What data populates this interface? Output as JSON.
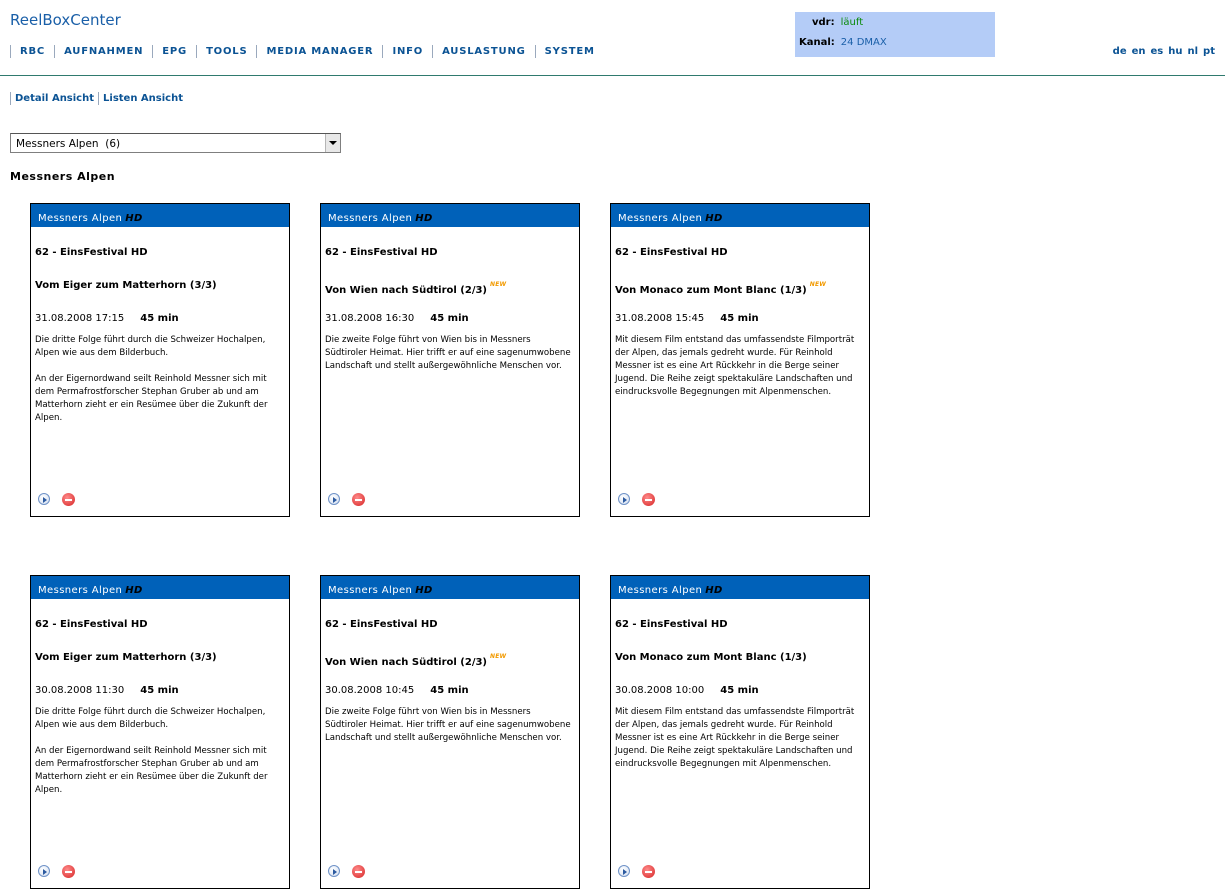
{
  "brand": "ReelBoxCenter",
  "nav": [
    "RBC",
    "AUFNAHMEN",
    "EPG",
    "TOOLS",
    "MEDIA MANAGER",
    "INFO",
    "AUSLASTUNG",
    "SYSTEM"
  ],
  "status": {
    "vdr_label": "vdr:",
    "vdr_value": "läuft",
    "vdr_color": "#0a8a0a",
    "channel_label": "Kanal:",
    "channel_value": "24 DMAX",
    "background": "#b4ccf7"
  },
  "languages": [
    "de",
    "en",
    "es",
    "hu",
    "nl",
    "pt"
  ],
  "subnav": [
    "Detail Ansicht",
    "Listen Ansicht"
  ],
  "series_select": {
    "value": "Messners Alpen  (6)"
  },
  "section_title": "Messners Alpen",
  "header_color": "#0061b9",
  "new_badge": "NEW",
  "cards": [
    {
      "series": "Messners Alpen",
      "hd": "HD",
      "channel": "62 - EinsFestival HD",
      "title": "Vom Eiger zum Matterhorn (3/3)",
      "is_new": false,
      "date": "31.08.2008 17:15",
      "duration": "45 min",
      "desc1": "Die dritte Folge führt durch die Schweizer Hochalpen, Alpen wie aus dem Bilderbuch.",
      "desc2": "An der Eigernordwand seilt Reinhold Messner sich mit dem Permafrostforscher Stephan Gruber ab und am Matterhorn zieht er ein Resümee über die Zukunft der Alpen."
    },
    {
      "series": "Messners Alpen",
      "hd": "HD",
      "channel": "62 - EinsFestival HD",
      "title": "Von Wien nach Südtirol (2/3)",
      "is_new": true,
      "date": "31.08.2008 16:30",
      "duration": "45 min",
      "desc1": "Die zweite Folge führt von Wien bis in Messners Südtiroler Heimat. Hier trifft er auf eine sagenumwobene Landschaft und stellt außergewöhnliche Menschen vor.",
      "desc2": ""
    },
    {
      "series": "Messners Alpen",
      "hd": "HD",
      "channel": "62 - EinsFestival HD",
      "title": "Von Monaco zum Mont Blanc (1/3)",
      "is_new": true,
      "date": "31.08.2008 15:45",
      "duration": "45 min",
      "desc1": "Mit diesem Film entstand das umfassendste Filmporträt der Alpen, das jemals gedreht wurde. Für Reinhold Messner ist es eine Art Rückkehr in die Berge seiner Jugend. Die Reihe zeigt spektakuläre Landschaften und eindrucksvolle Begegnungen mit Alpenmenschen.",
      "desc2": ""
    },
    {
      "series": "Messners Alpen",
      "hd": "HD",
      "channel": "62 - EinsFestival HD",
      "title": "Vom Eiger zum Matterhorn (3/3)",
      "is_new": false,
      "date": "30.08.2008 11:30",
      "duration": "45 min",
      "desc1": "Die dritte Folge führt durch die Schweizer Hochalpen, Alpen wie aus dem Bilderbuch.",
      "desc2": "An der Eigernordwand seilt Reinhold Messner sich mit dem Permafrostforscher Stephan Gruber ab und am Matterhorn zieht er ein Resümee über die Zukunft der Alpen."
    },
    {
      "series": "Messners Alpen",
      "hd": "HD",
      "channel": "62 - EinsFestival HD",
      "title": "Von Wien nach Südtirol (2/3)",
      "is_new": true,
      "date": "30.08.2008 10:45",
      "duration": "45 min",
      "desc1": "Die zweite Folge führt von Wien bis in Messners Südtiroler Heimat. Hier trifft er auf eine sagenumwobene Landschaft und stellt außergewöhnliche Menschen vor.",
      "desc2": ""
    },
    {
      "series": "Messners Alpen",
      "hd": "HD",
      "channel": "62 - EinsFestival HD",
      "title": "Von Monaco zum Mont Blanc (1/3)",
      "is_new": false,
      "date": "30.08.2008 10:00",
      "duration": "45 min",
      "desc1": "Mit diesem Film entstand das umfassendste Filmporträt der Alpen, das jemals gedreht wurde. Für Reinhold Messner ist es eine Art Rückkehr in die Berge seiner Jugend. Die Reihe zeigt spektakuläre Landschaften und eindrucksvolle Begegnungen mit Alpenmenschen.",
      "desc2": ""
    }
  ]
}
